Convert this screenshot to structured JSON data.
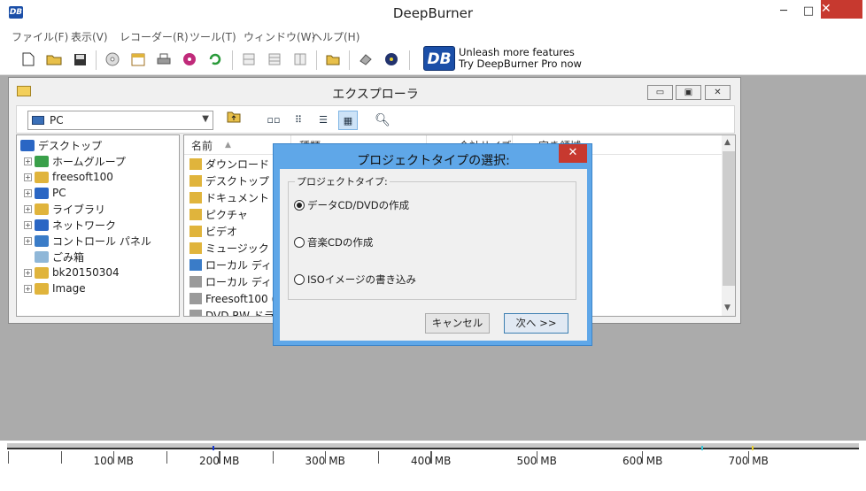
{
  "app": {
    "title": "DeepBurner",
    "icon_text": "DB"
  },
  "window_buttons": {
    "minimize": "─",
    "maximize": "□",
    "close": "✕"
  },
  "menu": [
    "ファイル(F)",
    "表示(V)",
    "レコーダー(R)",
    "ツール(T)",
    "ウィンドウ(W)",
    "ヘルプ(H)"
  ],
  "toolbar": {
    "icons": [
      "new-file-icon",
      "open-folder-icon",
      "save-icon",
      "disc-icon",
      "calendar-icon",
      "print-icon",
      "cd-burn-icon",
      "refresh-icon",
      "layout-1-icon",
      "layout-2-icon",
      "layout-3-icon",
      "folder-icon",
      "eraser-icon",
      "disc-info-icon"
    ]
  },
  "promo": {
    "logo": "DB",
    "line1": "Unleash more features",
    "line2": "Try DeepBurner Pro now"
  },
  "explorer": {
    "title": "エクスプローラ",
    "address": "PC",
    "tree": [
      {
        "label": "デスクトップ",
        "color": "#2a66c4",
        "expander": ""
      },
      {
        "label": "ホームグループ",
        "color": "#3aa04a",
        "expander": "+"
      },
      {
        "label": "freesoft100",
        "color": "#e0b43c",
        "expander": "+"
      },
      {
        "label": "PC",
        "color": "#2a66c4",
        "expander": "+"
      },
      {
        "label": "ライブラリ",
        "color": "#e0b43c",
        "expander": "+"
      },
      {
        "label": "ネットワーク",
        "color": "#2a66c4",
        "expander": "+"
      },
      {
        "label": "コントロール パネル",
        "color": "#3a7cc8",
        "expander": "+"
      },
      {
        "label": "ごみ箱",
        "color": "#8fb7d8",
        "expander": ""
      },
      {
        "label": "bk20150304",
        "color": "#e0b43c",
        "expander": "+"
      },
      {
        "label": "Image",
        "color": "#e0b43c",
        "expander": "+"
      }
    ],
    "columns": [
      "名前",
      "種類",
      "合計サイズ",
      "空き領域"
    ],
    "files": [
      {
        "name": "ダウンロード",
        "color": "#e0b43c"
      },
      {
        "name": "デスクトップ",
        "color": "#e0b43c"
      },
      {
        "name": "ドキュメント",
        "color": "#e0b43c"
      },
      {
        "name": "ピクチャ",
        "color": "#e0b43c"
      },
      {
        "name": "ビデオ",
        "color": "#e0b43c"
      },
      {
        "name": "ミュージック",
        "color": "#e0b43c"
      },
      {
        "name": "ローカル ディスク",
        "color": "#3a7cc8"
      },
      {
        "name": "ローカル ディスク",
        "color": "#9a9a9a"
      },
      {
        "name": "Freesoft100 (",
        "color": "#9a9a9a"
      },
      {
        "name": "DVD RW ドライ",
        "color": "#9a9a9a"
      }
    ]
  },
  "dialog": {
    "title": "プロジェクトタイプの選択:",
    "close": "✕",
    "group_label": "プロジェクトタイプ:",
    "options": [
      {
        "label": "データCD/DVDの作成",
        "selected": true
      },
      {
        "label": "音楽CDの作成",
        "selected": false
      },
      {
        "label": "ISOイメージの書き込み",
        "selected": false
      }
    ],
    "cancel": "キャンセル",
    "next": "次へ >>"
  },
  "ruler": {
    "labels": [
      "100 MB",
      "200 MB",
      "300 MB",
      "400 MB",
      "500 MB",
      "600 MB",
      "700 MB"
    ],
    "markers": {
      "blue": "#1a3ad0",
      "cyan": "#3cc8d8",
      "yellow": "#e8d030"
    }
  }
}
